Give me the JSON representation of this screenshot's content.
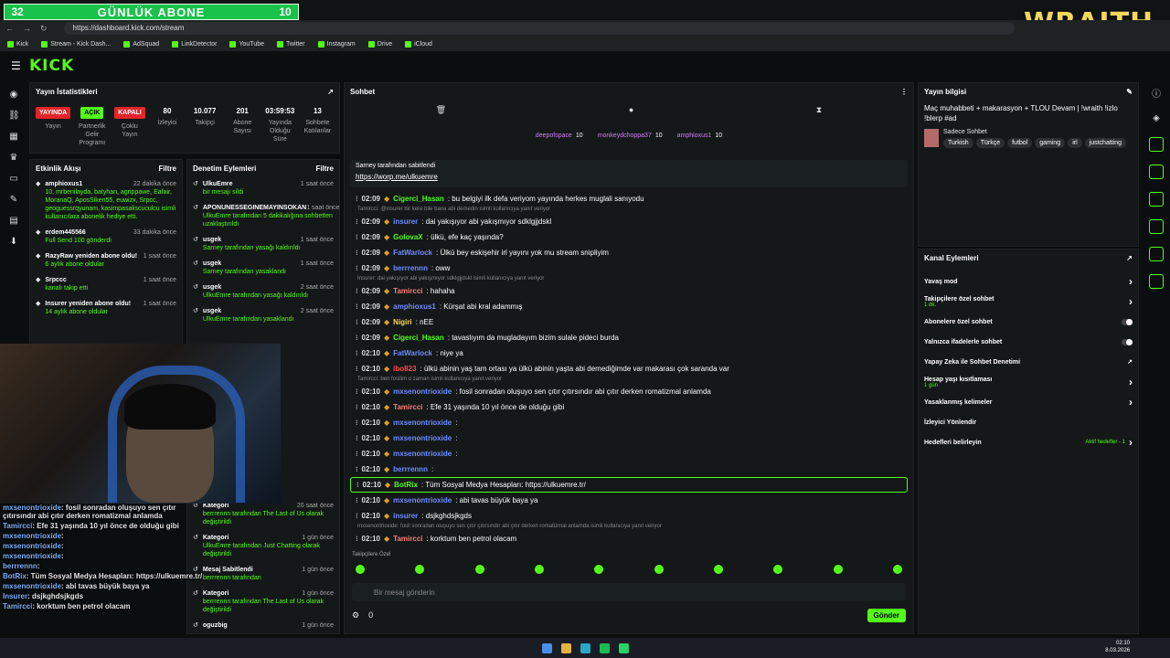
{
  "banner": {
    "left_num": "32",
    "title": "GÜNLÜK ABONE",
    "right_num": "10",
    "logo": "WRAITH"
  },
  "browser": {
    "url": "https://dashboard.kick.com/stream",
    "bookmarks": [
      "Kick",
      "Stream - Kick Dash...",
      "AdSquad",
      "LinkDetector",
      "YouTube",
      "Twitter",
      "Instagram",
      "Drive",
      "iCloud"
    ]
  },
  "stats": {
    "title": "Yayın İstatistikleri",
    "items": [
      {
        "v": "YAYINDA",
        "l": "Yayın",
        "kind": "red"
      },
      {
        "v": "AÇIK",
        "l": "Partnerlik Gelir Programı",
        "kind": "green"
      },
      {
        "v": "KAPALI",
        "l": "Çoklu Yayın",
        "kind": "red"
      },
      {
        "v": "80",
        "l": "İzleyici"
      },
      {
        "v": "10.077",
        "l": "Takipçi"
      },
      {
        "v": "201",
        "l": "Abone Sayısı"
      },
      {
        "v": "03:59:53",
        "l": "Yayında Olduğu Süre"
      },
      {
        "v": "13",
        "l": "Sohbete Katılanlar"
      }
    ]
  },
  "events": {
    "title": "Etkinlik Akışı",
    "filter": "Filtre",
    "items": [
      {
        "n": "amphioxus1",
        "t": "22 dakika önce",
        "d": "10, mrbenilayda, batyhan, agrippawe, Eafair, MoranaQ, AposSiken55, euwizx, Srpcc, geoguessrqyunam, kasimpasaliscuculcu isimli kullanıcılara abonelik hediye etti."
      },
      {
        "n": "erdem445566",
        "t": "33 dakika önce",
        "d": "Full Send 100 gönderdi"
      },
      {
        "n": "RazyRaw yeniden abone oldu!",
        "t": "1 saat önce",
        "d": "6 aylık abone oldular"
      },
      {
        "n": "Srpccc",
        "t": "1 saat önce",
        "d": "kanalı takip etti"
      },
      {
        "n": "Insurer yeniden abone oldu!",
        "t": "1 saat önce",
        "d": "14 aylık abone oldular"
      }
    ]
  },
  "mod": {
    "title": "Denetim Eylemleri",
    "filter": "Filtre",
    "items": [
      {
        "n": "UlkuEmre",
        "t": "1 saat önce",
        "d": "bir mesajı sildi"
      },
      {
        "n": "APONUNESSEGINEMAYINSOKAN",
        "t": "1 saat önce",
        "d": "UlkuEmre tarafından 5 dakikalığına sohbetten uzaklaştırıldı"
      },
      {
        "n": "usgek",
        "t": "1 saat önce",
        "d": "Sarney tarafından yasağı kaldırıldı"
      },
      {
        "n": "usgek",
        "t": "1 saat önce",
        "d": "Sarney tarafından yasaklandı"
      },
      {
        "n": "usgek",
        "t": "2 saat önce",
        "d": "UlkuEmre tarafından yasağı kaldırıldı"
      },
      {
        "n": "usgek",
        "t": "2 saat önce",
        "d": "UlkuEmre tarafından yasaklandı"
      }
    ],
    "lower": [
      {
        "n": "Kategori",
        "t": "20 saat önce",
        "d": "berrrennn tarafından The Last of Us olarak değiştirildi"
      },
      {
        "n": "Kategori",
        "t": "1 gün önce",
        "d": "UlkuEmre tarafından Just Chatting olarak değiştirildi"
      },
      {
        "n": "Mesaj Sabitlendi",
        "t": "1 gün önce",
        "d": "berrrennn tarafından"
      },
      {
        "n": "Kategori",
        "t": "1 gün önce",
        "d": "berrrennn tarafından The Last of Us olarak değiştirildi"
      },
      {
        "n": "oguzbig",
        "t": "1 gün önce",
        "d": ""
      }
    ]
  },
  "overlay": [
    {
      "u": "mxsenontrioxide",
      "m": ": fosil sonradan oluşuyo sen çıtır çıtırsındır abi çıtır derken romatizmal anlamda"
    },
    {
      "u": "Tamircci",
      "m": ": Efe 31 yaşında 10 yıl önce de olduğu gibi"
    },
    {
      "u": "mxsenontrioxide",
      "m": ":"
    },
    {
      "u": "mxsenontrioxide",
      "m": ":"
    },
    {
      "u": "mxsenontrioxide",
      "m": ":"
    },
    {
      "u": "berrrennn",
      "m": ":"
    },
    {
      "u": "BotRix",
      "m": ": Tüm Sosyal Medya Hesapları: https://ulkuemre.tr/"
    },
    {
      "u": "mxsenontrioxide",
      "m": ": abi tavas büyük baya ya"
    },
    {
      "u": "Insurer",
      "m": ": dsjkghdsjkgds"
    },
    {
      "u": "Tamircci",
      "m": ": korktum ben petrol olacam"
    }
  ],
  "chat": {
    "title": "Sohbet",
    "gifters": [
      {
        "n": "deepofspace",
        "v": "10"
      },
      {
        "n": "monkeydchoppa37",
        "v": "10"
      },
      {
        "n": "amphioxus1",
        "v": "10"
      }
    ],
    "pinned_by": "Sarney tarafından sabitlendi",
    "pinned_link": "https://worp.me/ulkuemre",
    "messages": [
      {
        "t": "02:09",
        "u": "Cigerci_Hasan",
        "c": "#53fc18",
        "m": ": bu belgiyi ilk defa veriyom yayında herkes muglali sanıyodu"
      },
      {
        "r": "Tamircci: @insurer bir kere bile bana abi demedin isimli kullanıcıya yanıt veriyor"
      },
      {
        "t": "02:09",
        "u": "insurer",
        "c": "#6f8cff",
        "m": ": dai yakışıyor abi yakışmıyor sdklgjjdskl"
      },
      {
        "t": "02:09",
        "u": "GolovaX",
        "c": "#53fc18",
        "m": ": ülkü, efe kaç yaşında?"
      },
      {
        "t": "02:09",
        "u": "FatWarlock",
        "c": "#6f8cff",
        "m": ": Ülkü bey eskişehir irl yayını yok mu stream snipliyim"
      },
      {
        "t": "02:09",
        "u": "berrrennn",
        "c": "#6f8cff",
        "m": ": oww"
      },
      {
        "r": "Insurer: dai yakışıyor abi yakışmıyor sdklgjjdskl isimli kullanıcıya yanıt veriyor"
      },
      {
        "t": "02:09",
        "u": "Tamircci",
        "c": "#ff7b7b",
        "m": ": hahaha"
      },
      {
        "t": "02:09",
        "u": "amphioxus1",
        "c": "#6f8cff",
        "m": ": Kürşat abi kral adammış"
      },
      {
        "t": "02:09",
        "u": "Nigiri",
        "c": "#ffd84a",
        "m": ": nEE"
      },
      {
        "t": "02:09",
        "u": "Cigerci_Hasan",
        "c": "#53fc18",
        "m": ": tavaslıyım da mugladayım bizim sulale pideci burda"
      },
      {
        "t": "02:10",
        "u": "FatWarlock",
        "c": "#6f8cff",
        "m": ": niye ya"
      },
      {
        "t": "02:10",
        "u": "ibo823",
        "c": "#ff4a4a",
        "m": ": ülkü abinin yaş tam ortası ya ülkü abinin yaşta abi demediğimde var makarası çok saranda var"
      },
      {
        "r": "Tamircci: ben fosilim o zaman isimli kullanıcıya yanıt veriyor"
      },
      {
        "t": "02:10",
        "u": "mxsenontrioxide",
        "c": "#6f8cff",
        "m": ": fosil sonradan oluşuyo sen çıtır çıtırsındır abi çıtır derken romatizmal anlamda"
      },
      {
        "t": "02:10",
        "u": "Tamircci",
        "c": "#ff7b7b",
        "m": ": Efe 31 yaşında 10 yıl önce de olduğu gibi"
      },
      {
        "t": "02:10",
        "u": "mxsenontrioxide",
        "c": "#6f8cff",
        "m": ":"
      },
      {
        "t": "02:10",
        "u": "mxsenontrioxide",
        "c": "#6f8cff",
        "m": ":"
      },
      {
        "t": "02:10",
        "u": "mxsenontrioxide",
        "c": "#6f8cff",
        "m": ":"
      },
      {
        "t": "02:10",
        "u": "berrrennn",
        "c": "#6f8cff",
        "m": ":"
      },
      {
        "t": "02:10",
        "u": "BotRix",
        "c": "#53fc18",
        "m": ": Tüm Sosyal Medya Hesapları: https://ulkuemre.tr/",
        "hl": true
      },
      {
        "t": "02:10",
        "u": "mxsenontrioxide",
        "c": "#6f8cff",
        "m": ": abi tavas büyük baya ya"
      },
      {
        "t": "02:10",
        "u": "insurer",
        "c": "#6f8cff",
        "m": ": dsjkghdsjkgds"
      },
      {
        "r": "mxsenontrioxide: fosil sonradan oluşuyo sen çıtır çıtırsındır abi çıtır derken romatizmal anlamda isimli kullanıcıya yanıt veriyor"
      },
      {
        "t": "02:10",
        "u": "Tamircci",
        "c": "#ff7b7b",
        "m": ": korktum ben petrol olacam"
      }
    ],
    "followers_label": "Takipçilere Özel",
    "input_placeholder": "Bir mesaj gönderin",
    "points": "0",
    "send": "Gönder"
  },
  "info": {
    "title": "Yayın bilgisi",
    "stream_title": "Maç muhabbeti + makarasyon + TLOU Devam | !wraith !izlo !blerp #ad",
    "chat_label": "Sadece Sohbet",
    "tags": [
      "Turkish",
      "Türkçe",
      "futbol",
      "gaming",
      "irl",
      "justchatting"
    ]
  },
  "actions": {
    "title": "Kanal Eylemleri",
    "items": [
      {
        "l": "Yavaş mod",
        "k": "arrow"
      },
      {
        "l": "Takipçilere özel sohbet",
        "s": "1 dk.",
        "k": "arrow"
      },
      {
        "l": "Abonelere özel sohbet",
        "k": "toggle"
      },
      {
        "l": "Yalnızca ifadelerle sohbet",
        "k": "toggle"
      },
      {
        "l": "Yapay Zeka ile Sohbet Denetimi",
        "k": "ext"
      },
      {
        "l": "Hesap yaşı kısıtlaması",
        "s": "1 gün",
        "k": "arrow"
      },
      {
        "l": "Yasaklanmış kelimeler",
        "k": "arrow"
      },
      {
        "l": "İzleyici Yönlendir",
        "k": "none"
      },
      {
        "l": "Hedefleri belirleyin",
        "k": "arrow",
        "extra": "Aktif hedefler - 1"
      }
    ]
  },
  "clock": {
    "time": "02:10",
    "date": "8.03.2026"
  }
}
